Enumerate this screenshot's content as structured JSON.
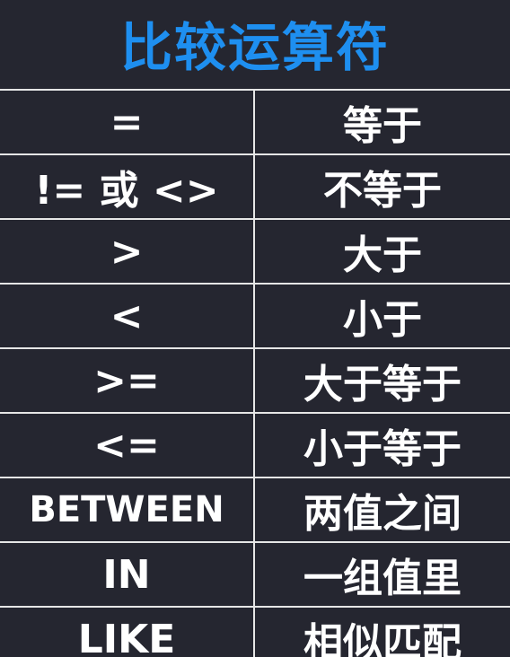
{
  "title": "比较运算符",
  "rows": [
    {
      "operator": "=",
      "meaning": "等于"
    },
    {
      "operator": "!= 或 <>",
      "meaning": "不等于"
    },
    {
      "operator": ">",
      "meaning": "大于"
    },
    {
      "operator": "<",
      "meaning": "小于"
    },
    {
      "operator": ">=",
      "meaning": "大于等于"
    },
    {
      "operator": "<=",
      "meaning": "小于等于"
    },
    {
      "operator": "BETWEEN",
      "meaning": "两值之间"
    },
    {
      "operator": "IN",
      "meaning": "一组值里"
    },
    {
      "operator": "LIKE",
      "meaning": "相似匹配"
    }
  ],
  "colors": {
    "background": "#252630",
    "title": "#1e8ff0",
    "text": "#ffffff",
    "grid": "#e6e6e6"
  }
}
